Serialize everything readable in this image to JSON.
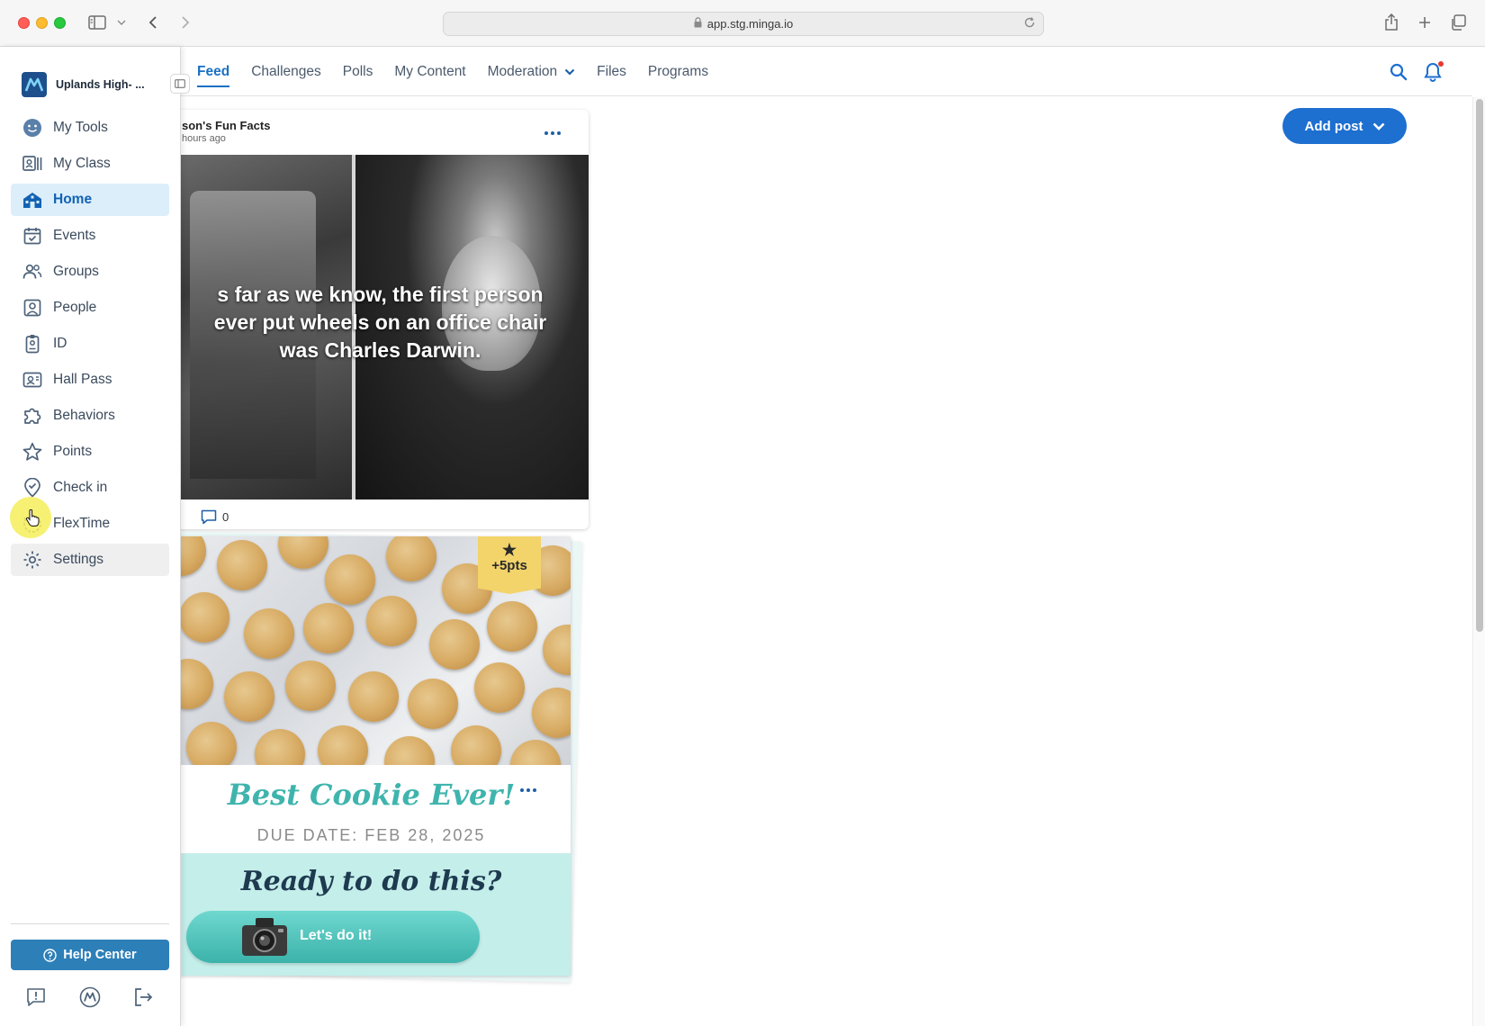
{
  "browser": {
    "url": "app.stg.minga.io"
  },
  "sidebar": {
    "school_name": "Uplands High- ...",
    "items": [
      {
        "label": "My Tools",
        "icon": "smiley-icon"
      },
      {
        "label": "My Class",
        "icon": "class-roster-icon"
      },
      {
        "label": "Home",
        "icon": "home-school-icon"
      },
      {
        "label": "Events",
        "icon": "calendar-check-icon"
      },
      {
        "label": "Groups",
        "icon": "groups-icon"
      },
      {
        "label": "People",
        "icon": "person-badge-icon"
      },
      {
        "label": "ID",
        "icon": "id-card-icon"
      },
      {
        "label": "Hall Pass",
        "icon": "hall-pass-icon"
      },
      {
        "label": "Behaviors",
        "icon": "puzzle-icon"
      },
      {
        "label": "Points",
        "icon": "star-icon"
      },
      {
        "label": "Check in",
        "icon": "location-check-icon"
      },
      {
        "label": "FlexTime",
        "icon": "flextime-icon"
      },
      {
        "label": "Settings",
        "icon": "gear-icon"
      }
    ],
    "active_item": "Home",
    "hovered_item": "Settings",
    "help_center_label": "Help Center"
  },
  "topnav": {
    "tabs": [
      {
        "label": "Feed"
      },
      {
        "label": "Challenges"
      },
      {
        "label": "Polls"
      },
      {
        "label": "My Content"
      },
      {
        "label": "Moderation"
      },
      {
        "label": "Files"
      },
      {
        "label": "Programs"
      }
    ],
    "active_tab": "Feed"
  },
  "content": {
    "add_post_label": "Add post",
    "post1": {
      "author": "son's Fun Facts",
      "time": "hours ago",
      "caption": "s far as we know, the first person\n ever put wheels on an office chair\nwas Charles Darwin.",
      "comment_count": "0"
    },
    "challenge": {
      "points_badge": "+5pts",
      "title": "Best Cookie Ever!",
      "due_date": "DUE DATE: FEB 28, 2025",
      "ready_text": "Ready to do this?",
      "action_label": "Let's do it!"
    }
  },
  "colors": {
    "brand_blue": "#1d6fd0",
    "active_tab": "#1b70c4",
    "help_button": "#2d7fb8",
    "challenge_teal": "#3fb4ad",
    "points_badge": "#f3d46a"
  }
}
